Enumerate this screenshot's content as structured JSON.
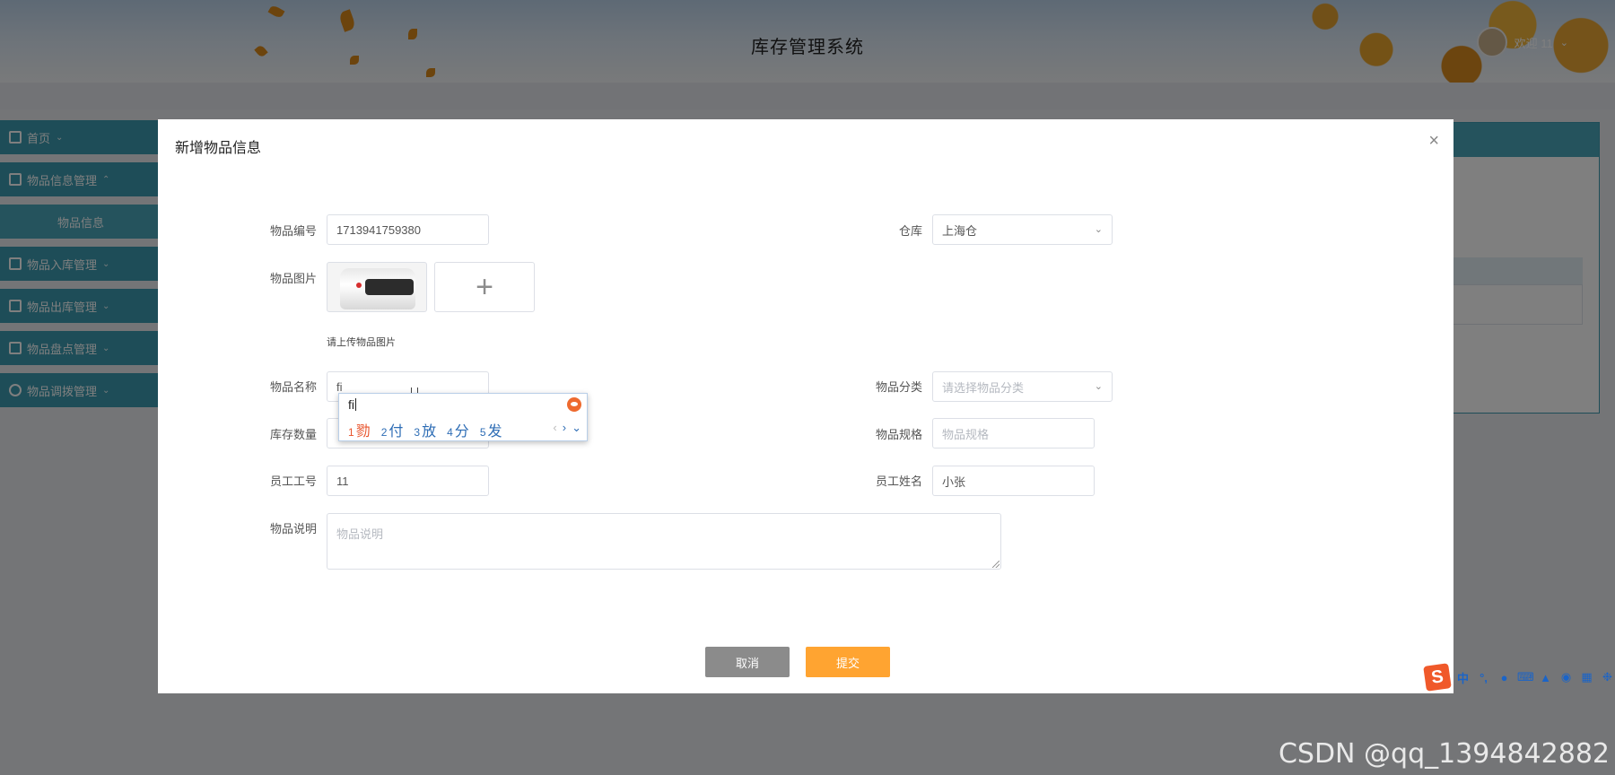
{
  "app": {
    "title": "库存管理系统",
    "welcome": "欢迎 11"
  },
  "sidebar": {
    "items": [
      {
        "label": "首页",
        "icon": "home-icon"
      },
      {
        "label": "物品信息管理",
        "icon": "grid-icon"
      },
      {
        "label": "物品信息",
        "icon": ""
      },
      {
        "label": "物品入库管理",
        "icon": "inbox-icon"
      },
      {
        "label": "物品出库管理",
        "icon": "outbox-icon"
      },
      {
        "label": "物品盘点管理",
        "icon": "inventory-icon"
      },
      {
        "label": "物品调拨管理",
        "icon": "transfer-icon"
      }
    ]
  },
  "modal": {
    "title": "新增物品信息",
    "close_symbol": "×",
    "fields": {
      "code": {
        "label": "物品编号",
        "value": "1713941759380"
      },
      "warehouse": {
        "label": "仓库",
        "value": "上海仓"
      },
      "image": {
        "label": "物品图片",
        "hint": "请上传物品图片",
        "add_symbol": "+"
      },
      "name": {
        "label": "物品名称",
        "value": "fi"
      },
      "category": {
        "label": "物品分类",
        "placeholder": "请选择物品分类"
      },
      "stock": {
        "label": "库存数量",
        "value": ""
      },
      "spec": {
        "label": "物品规格",
        "placeholder": "物品规格"
      },
      "employee_id": {
        "label": "员工工号",
        "value": "11"
      },
      "employee_name": {
        "label": "员工姓名",
        "value": "小张"
      },
      "description": {
        "label": "物品说明",
        "placeholder": "物品说明"
      }
    },
    "buttons": {
      "cancel": "取消",
      "submit": "提交"
    }
  },
  "ime_popup": {
    "composition": "fi",
    "candidates": [
      {
        "num": "1",
        "text": "勠"
      },
      {
        "num": "2",
        "text": "付"
      },
      {
        "num": "3",
        "text": "放"
      },
      {
        "num": "4",
        "text": "分"
      },
      {
        "num": "5",
        "text": "发"
      }
    ]
  },
  "ime_bar": {
    "logo": "S",
    "mode": "中"
  },
  "watermark": "CSDN @qq_1394842882",
  "colors": {
    "sidebar": "#3c9bb0",
    "submit": "#ffa431",
    "cancel": "#8b8b8b",
    "ime_highlight": "#e8522a"
  }
}
